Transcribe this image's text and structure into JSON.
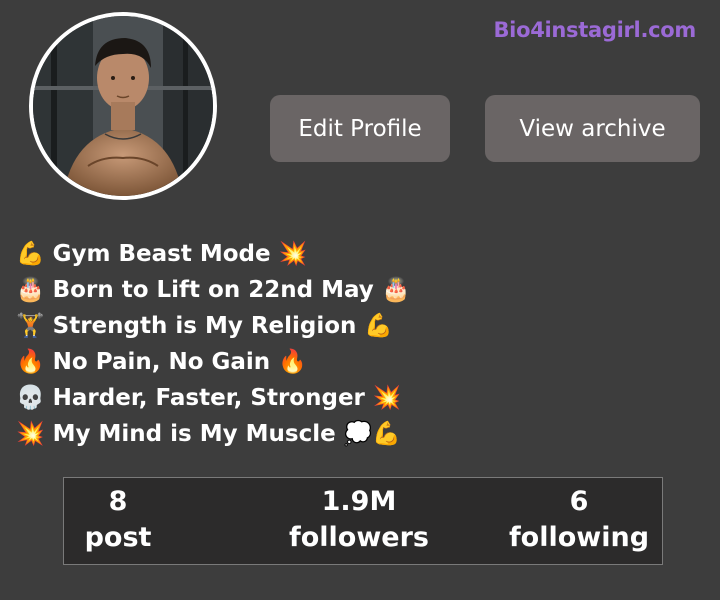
{
  "watermark": "Bio4instagirl.com",
  "profile": {
    "avatar_icon": "avatar-photo"
  },
  "actions": {
    "edit_profile": "Edit Profile",
    "view_archive": "View archive"
  },
  "bio": [
    "💪 Gym Beast Mode 💥",
    "🎂 Born to Lift on 22nd May 🎂",
    "🏋 Strength is My Religion 💪",
    "🔥 No Pain, No Gain 🔥",
    "💀 Harder, Faster, Stronger 💥",
    "💥 My Mind is My Muscle 💭💪"
  ],
  "stats": {
    "post": {
      "value": "8",
      "label": "post"
    },
    "followers": {
      "value": "1.9M",
      "label": "followers"
    },
    "following": {
      "value": "6",
      "label": "following"
    }
  },
  "colors": {
    "background": "#3d3d3d",
    "button": "#6a6565",
    "watermark": "#9b6ad6",
    "stats_box": "#2c2b2b"
  }
}
